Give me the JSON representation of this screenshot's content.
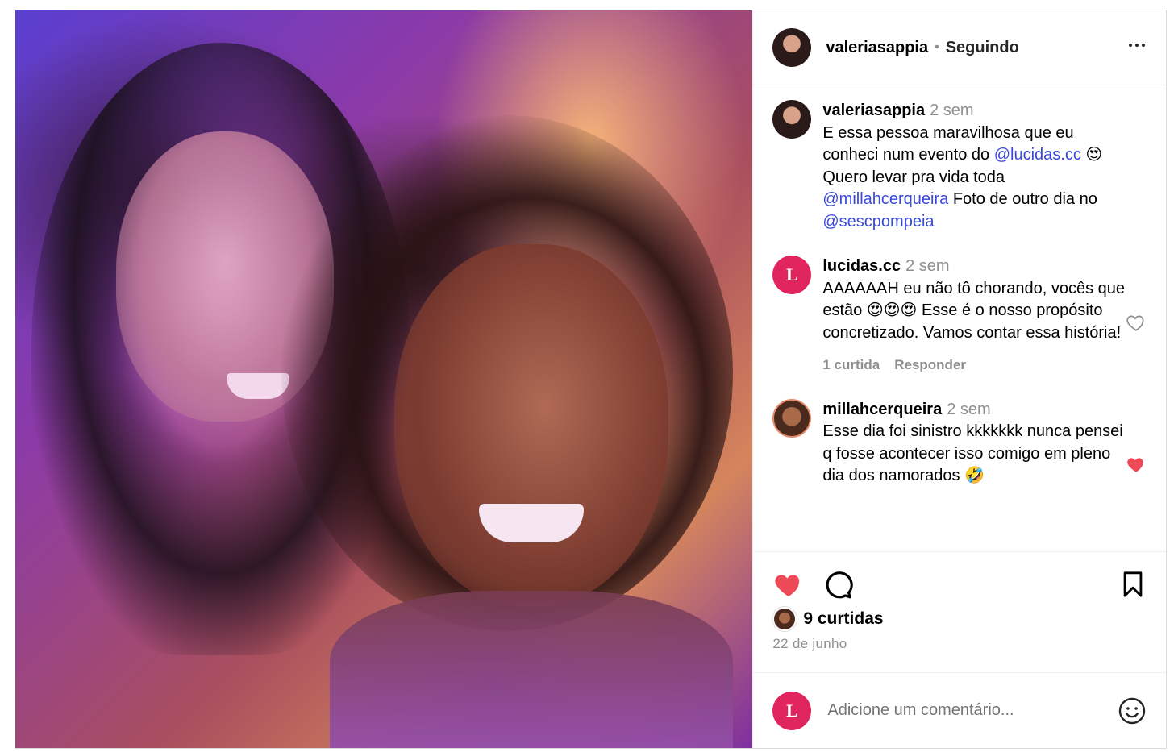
{
  "post": {
    "username": "valeriasappia",
    "separator": "•",
    "follow_status": "Seguindo",
    "more_label": "•••"
  },
  "comments": [
    {
      "username": "valeriasappia",
      "time": "2 sem",
      "parts": [
        {
          "type": "text",
          "value": "E essa pessoa maravilhosa que eu conheci num evento do "
        },
        {
          "type": "mention",
          "value": "@lucidas.cc"
        },
        {
          "type": "text",
          "value": " 😍 Quero levar pra vida toda "
        },
        {
          "type": "mention",
          "value": "@millahcerqueira"
        },
        {
          "type": "text",
          "value": " Foto de outro dia no "
        },
        {
          "type": "mention",
          "value": "@sescpompeia"
        }
      ]
    },
    {
      "username": "lucidas.cc",
      "time": "2 sem",
      "avatar_letter": "L",
      "text": "AAAAAAH eu não tô chorando, vocês que estão 😍😍😍 Esse é o nosso propósito concretizado. Vamos contar essa história!",
      "likes_label": "1 curtida",
      "reply_label": "Responder"
    },
    {
      "username": "millahcerqueira",
      "time": "2 sem",
      "text": "Esse dia foi sinistro kkkkkkk nunca pensei q fosse acontecer isso comigo em pleno dia dos namorados 🤣"
    }
  ],
  "likes": {
    "count_label": "9 curtidas"
  },
  "date_label": "22 de junho",
  "add_comment": {
    "avatar_letter": "L",
    "placeholder": "Adicione um comentário..."
  },
  "colors": {
    "like_red": "#ed4956",
    "mention_blue": "#3a4ad8",
    "brand_red": "#e0245e",
    "muted_gray": "#8e8e8e"
  },
  "icons": {
    "like": "heart-icon",
    "comment": "comment-bubble-icon",
    "save": "bookmark-icon",
    "more": "more-options-icon",
    "emoji": "emoji-smile-icon"
  }
}
